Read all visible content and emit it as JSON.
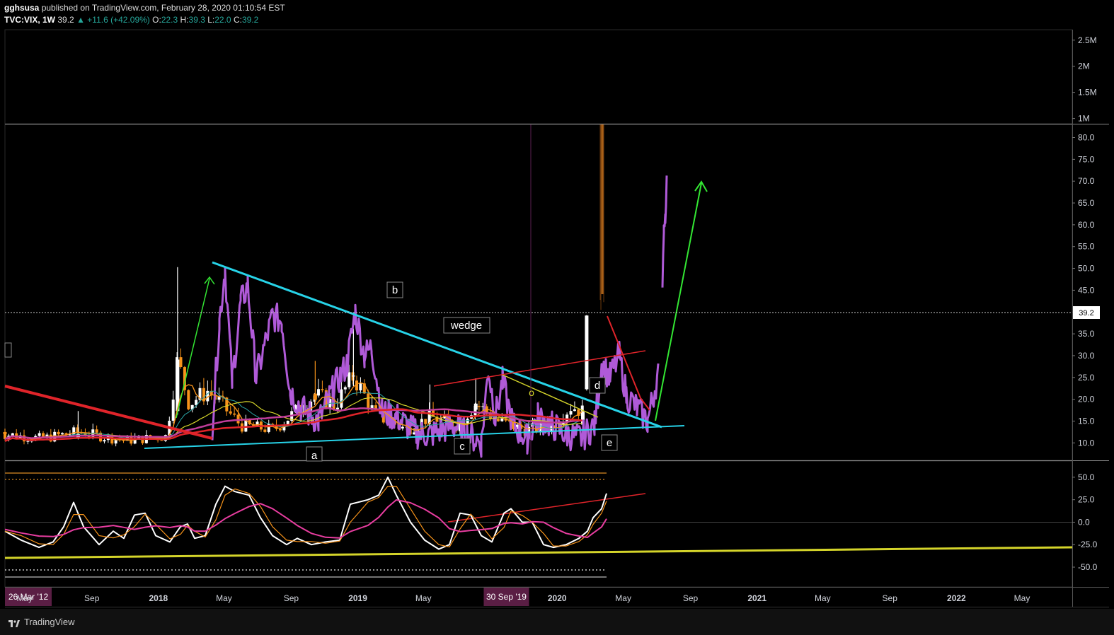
{
  "header": {
    "publisher": "gghsusa",
    "published_text": "published on TradingView.com, February 28, 2020 01:10:54 EST",
    "symbol": "TVC:VIX, 1W",
    "last": "39.2",
    "change": "+11.6 (+42.09%)",
    "open_label": "O:",
    "open": "22.3",
    "high_label": "H:",
    "high": "39.3",
    "low_label": "L:",
    "low": "22.0",
    "close_label": "C:",
    "close": "39.2"
  },
  "footer": {
    "brand": "TradingView"
  },
  "colors": {
    "bg": "#000000",
    "grid_text": "#d1d4dc",
    "up": "#ffffff",
    "down": "#f7931a",
    "projection": "#b05ad8",
    "trend_cyan": "#27d3e8",
    "arrow_green": "#33e633",
    "line_red": "#e0242a",
    "line_yellow": "#d4d42a",
    "osc_white": "#ffffff",
    "osc_orange": "#f7931a",
    "osc_pink": "#e83da0"
  },
  "chart_data": [
    {
      "type": "bar",
      "pane": "volume",
      "y_ticks": [
        "2.5M",
        "2M",
        "1.5M",
        "1M"
      ],
      "ylim": [
        900000,
        2700000
      ]
    },
    {
      "type": "candlestick",
      "pane": "price",
      "symbol": "TVC:VIX",
      "interval": "1W",
      "x_ticks": [
        "26 Mar '12",
        "May",
        "Sep",
        "2018",
        "May",
        "Sep",
        "2019",
        "May",
        "30 Sep '19",
        "2020",
        "May",
        "Sep",
        "2021",
        "May",
        "Sep",
        "2022",
        "May"
      ],
      "x_range": [
        "2017-03-26",
        "2022-08-01"
      ],
      "y_ticks": [
        "80.0",
        "75.0",
        "70.0",
        "65.0",
        "60.0",
        "55.0",
        "50.0",
        "45.0",
        "40.0",
        "35.0",
        "30.0",
        "25.0",
        "20.0",
        "15.0",
        "10.0"
      ],
      "ylim": [
        6,
        83
      ],
      "last_price_label": "39.2",
      "last_price": 39.2,
      "annotations": [
        "b",
        "wedge",
        "a",
        "c",
        "d",
        "e",
        "o"
      ],
      "candles_sample": [
        {
          "date": "2017-03-26",
          "o": 12.5,
          "h": 13.2,
          "l": 11.4,
          "c": 12.0
        },
        {
          "date": "2017-08-07",
          "o": 11.2,
          "h": 17.3,
          "l": 10.8,
          "c": 12.1
        },
        {
          "date": "2018-02-05",
          "o": 17.3,
          "h": 50.3,
          "l": 16.5,
          "c": 29.1
        },
        {
          "date": "2018-10-15",
          "o": 21.3,
          "h": 28.8,
          "l": 18.9,
          "c": 19.9
        },
        {
          "date": "2018-12-24",
          "o": 25.4,
          "h": 36.2,
          "l": 23.0,
          "c": 25.4
        },
        {
          "date": "2019-05-13",
          "o": 16.0,
          "h": 23.4,
          "l": 14.3,
          "c": 16.0
        },
        {
          "date": "2019-08-05",
          "o": 17.6,
          "h": 24.8,
          "l": 16.0,
          "c": 19.0
        },
        {
          "date": "2020-02-17",
          "o": 14.2,
          "h": 17.1,
          "l": 13.4,
          "c": 17.1
        },
        {
          "date": "2020-02-24",
          "o": 22.3,
          "h": 39.3,
          "l": 22.0,
          "c": 39.2
        }
      ]
    },
    {
      "type": "line",
      "pane": "oscillator",
      "y_ticks": [
        "50.0",
        "25.0",
        "0.0",
        "-25.0",
        "-50.0"
      ],
      "ylim": [
        -72,
        68
      ]
    }
  ]
}
